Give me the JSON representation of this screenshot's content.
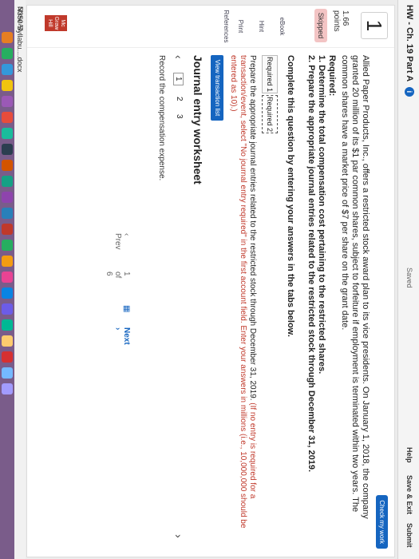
{
  "header": {
    "title": "HW - Ch. 19 Part A",
    "saved": "Saved",
    "help": "Help",
    "save_exit": "Save & Exit",
    "submit": "Submit",
    "check_my_work": "Check my work"
  },
  "sidebar": {
    "question_number": "1",
    "points": "1.66",
    "points_label": "points",
    "status": "Skipped",
    "ebook": "eBook",
    "hint": "Hint",
    "print": "Print",
    "references": "References"
  },
  "question": {
    "text": "Allied Paper Products, Inc., offers a restricted stock award plan to its vice presidents. On January 1, 2018, the company granted 20 million of its $1 par common shares, subject to forfeiture if employment is terminated within two years. The common shares have a market price of $7 per share on the grant date.",
    "required_label": "Required:",
    "req1": "1. Determine the total compensation cost pertaining to the restricted shares.",
    "req2": "2. Prepare the appropriate journal entries related to the restricted stock through December 31, 2019."
  },
  "complete_text": "Complete this question by entering your answers in the tabs below.",
  "tabs": [
    "Required 1",
    "Required 2"
  ],
  "instructions": {
    "black": "Prepare the appropriate journal entries related to the restricted stock through December 31, 2019.",
    "red": "(If no entry is required for a transaction/event, select \"No journal entry required\" in the first account field. Enter your answers in millions (i.e., 10,000,000 should be entered as 10).)"
  },
  "view_transaction_list": "View transaction list",
  "worksheet": {
    "title": "Journal entry worksheet",
    "pages": [
      "1",
      "2",
      "3"
    ],
    "record_text": "Record the compensation expense."
  },
  "footer": {
    "prev": "Prev",
    "page_of": "1 of 6",
    "next": "Next"
  },
  "download_bar": {
    "file": "N350 Syllabu....docx",
    "show_all": "Show All"
  },
  "logo_text": "Mc Graw Hill"
}
